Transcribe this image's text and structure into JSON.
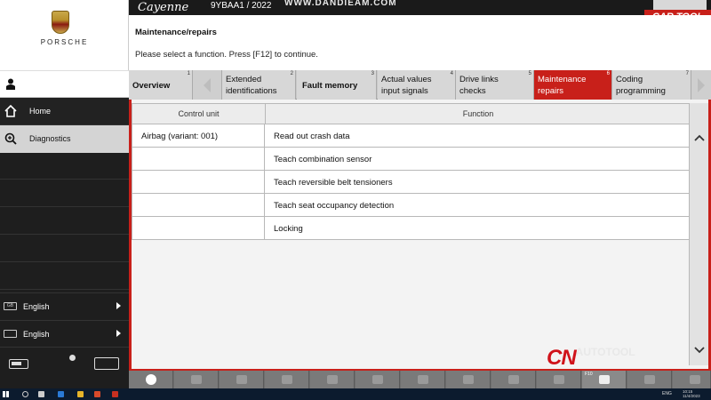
{
  "brand": "PORSCHE",
  "topbar": {
    "model": "Cayenne",
    "variant": "9YBAA1 / 2022",
    "watermark_url": "WWW.DANDIEAM.COM"
  },
  "header": {
    "title": "Maintenance/repairs",
    "instruction": "Please select a function. Press [F12] to continue."
  },
  "sidebar": {
    "items": [
      {
        "label": "Home",
        "icon": "house-icon"
      },
      {
        "label": "Diagnostics",
        "icon": "magnifier-plus-icon"
      }
    ],
    "languages": [
      {
        "label": "English",
        "icon": "gb-flag-icon",
        "badge": "GB"
      },
      {
        "label": "English",
        "icon": "keyboard-icon",
        "badge": ""
      }
    ]
  },
  "tabs": [
    {
      "label": "Overview",
      "num": "1"
    },
    {
      "label": "Extended identifications",
      "num": "2"
    },
    {
      "label": "Fault memory",
      "num": "3"
    },
    {
      "label": "Actual values input signals",
      "num": "4"
    },
    {
      "label": "Drive links checks",
      "num": "5"
    },
    {
      "label": "Maintenance repairs",
      "num": "6"
    },
    {
      "label": "Coding programming",
      "num": "7"
    }
  ],
  "table": {
    "headers": [
      "Control unit",
      "Function"
    ],
    "rows": [
      {
        "unit": "Airbag (variant: 001)",
        "func": "Read out crash data"
      },
      {
        "unit": "",
        "func": "Teach combination sensor"
      },
      {
        "unit": "",
        "func": "Teach reversible belt tensioners"
      },
      {
        "unit": "",
        "func": "Teach seat occupancy detection"
      },
      {
        "unit": "",
        "func": "Locking"
      }
    ]
  },
  "toolbar": {
    "f10_label": "F10",
    "watermark_main": "CN",
    "watermark_sub": "AUTOTOOL"
  },
  "corner_watermark": "CAR TOOL",
  "taskbar": {
    "lang": "ENG",
    "time": "10:15",
    "date": "11/4/2023"
  },
  "colors": {
    "accent_red": "#c8201a",
    "sidebar_dark": "#1e1e1e",
    "selected_item": "#d4d4d4"
  }
}
